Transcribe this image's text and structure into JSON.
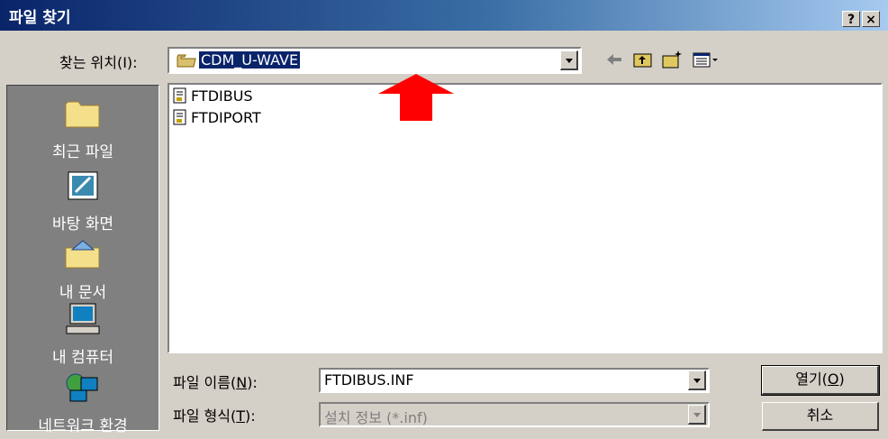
{
  "window": {
    "title": "파일 찾기",
    "help_label": "?",
    "close_label": "×"
  },
  "lookin": {
    "label": "찾는 위치(I):",
    "value": "CDM_U-WAVE"
  },
  "places": [
    {
      "label": "최근 파일",
      "icon": "folder-icon"
    },
    {
      "label": "바탕 화면",
      "icon": "desktop-icon"
    },
    {
      "label": "내 문서",
      "icon": "my-documents-icon"
    },
    {
      "label": "내 컴퓨터",
      "icon": "computer-icon"
    },
    {
      "label": "네트워크 환경",
      "icon": "network-icon"
    }
  ],
  "files": [
    {
      "name": "FTDIBUS",
      "icon": "inf-file-icon"
    },
    {
      "name": "FTDIPORT",
      "icon": "inf-file-icon"
    }
  ],
  "filename": {
    "label_prefix": "파일 이름(",
    "label_key": "N",
    "label_suffix": "):",
    "value": "FTDIBUS.INF"
  },
  "filetype": {
    "label_prefix": "파일 형식(",
    "label_key": "T",
    "label_suffix": "):",
    "value": "설치 정보 (*.inf)"
  },
  "buttons": {
    "open_prefix": "열기(",
    "open_key": "O",
    "open_suffix": ")",
    "cancel": "취소"
  },
  "colors": {
    "title_start": "#0a246a",
    "title_end": "#a6caf0",
    "selection": "#0a246a",
    "annotation_arrow": "#ff0000"
  }
}
